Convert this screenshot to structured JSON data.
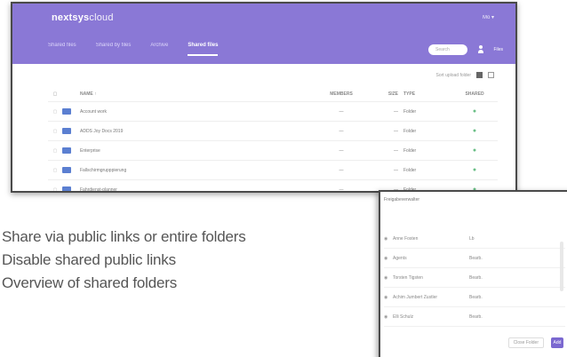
{
  "app": {
    "logo_bold": "nextsys",
    "logo_thin": "cloud",
    "user_menu": "Mo ▾",
    "nav": [
      "Shared files",
      "Shared by files",
      "Archive",
      "Shared files"
    ],
    "active_nav_index": 3,
    "search_placeholder": "Search",
    "user_label": "Files",
    "toolbar_label": "Sort upload folder",
    "columns": {
      "name": "NAME ↑",
      "members": "MEMBERS",
      "size": "SIZE",
      "type": "TYPE",
      "status": "SHARED"
    },
    "rows": [
      {
        "name": "Account work",
        "members": "—",
        "size": "—",
        "type": "Folder",
        "status": "●"
      },
      {
        "name": "ADDS Joy Docs 2019",
        "members": "—",
        "size": "—",
        "type": "Folder",
        "status": "●"
      },
      {
        "name": "Enterprise",
        "members": "—",
        "size": "—",
        "type": "Folder",
        "status": "●"
      },
      {
        "name": "Fallschirmgrupppierung",
        "members": "—",
        "size": "—",
        "type": "Folder",
        "status": "●"
      },
      {
        "name": "Fahrdienst-planner",
        "members": "—",
        "size": "—",
        "type": "Folder",
        "status": "●"
      }
    ]
  },
  "features": [
    "Share via public links or entire  folders",
    "Disable shared public links",
    "Overview of shared folders"
  ],
  "dialog": {
    "title": "Freigabeverwalter",
    "rows": [
      {
        "name": "Anne Fosten",
        "role": "Lb"
      },
      {
        "name": "Agents",
        "role": "Bearb."
      },
      {
        "name": "Torsten Tigsten",
        "role": "Bearb."
      },
      {
        "name": "Achim Jumbert Zustler",
        "role": "Bearb."
      },
      {
        "name": "Elli Schulz",
        "role": "Bearb."
      }
    ],
    "cancel_label": "Close Folder",
    "save_label": "Add"
  }
}
